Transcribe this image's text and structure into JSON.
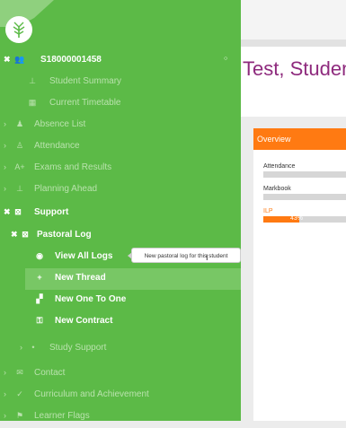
{
  "student": {
    "name": "Test, Student",
    "id": "S18000001458"
  },
  "overview": {
    "title": "Overview",
    "metrics": [
      {
        "label": "Attendance",
        "value": ""
      },
      {
        "label": "Markbook",
        "value": ""
      },
      {
        "label": "ILP",
        "value": "43%",
        "fill_fraction": 0.43
      }
    ]
  },
  "sidebar": {
    "items": [
      {
        "label": "S18000001458",
        "icon": "users-icon",
        "state": "expanded-bold"
      },
      {
        "label": "Student Summary",
        "icon": "summary-icon",
        "state": "faded"
      },
      {
        "label": "Current Timetable",
        "icon": "calendar-icon",
        "state": "faded"
      },
      {
        "label": "Absence List",
        "icon": "person-icon",
        "state": "faded"
      },
      {
        "label": "Attendance",
        "icon": "attendance-icon",
        "state": "faded"
      },
      {
        "label": "Exams and Results",
        "icon": "grade-icon",
        "state": "faded"
      },
      {
        "label": "Planning Ahead",
        "icon": "planning-icon",
        "state": "faded"
      },
      {
        "label": "Support",
        "icon": "support-icon",
        "state": "bold"
      },
      {
        "label": "Pastoral Log",
        "icon": "log-icon",
        "state": "bold"
      },
      {
        "label": "View All Logs",
        "icon": "eye-icon",
        "state": "bold"
      },
      {
        "label": "New Thread",
        "icon": "plus-icon",
        "state": "bold"
      },
      {
        "label": "New One To One",
        "icon": "meeting-icon",
        "state": "bold"
      },
      {
        "label": "New Contract",
        "icon": "contract-icon",
        "state": "bold"
      },
      {
        "label": "Study Support",
        "icon": "pin-icon",
        "state": "faded"
      },
      {
        "label": "Contact",
        "icon": "mail-icon",
        "state": "faded"
      },
      {
        "label": "Curriculum and Achievement",
        "icon": "check-icon",
        "state": "faded"
      },
      {
        "label": "Learner Flags",
        "icon": "flag-icon",
        "state": "faded"
      }
    ]
  },
  "tooltip": {
    "text": "New pastoral log for this student"
  },
  "colors": {
    "sidebar": "#5cba47",
    "accent": "#ff7a12",
    "name": "#8e2a7d"
  }
}
